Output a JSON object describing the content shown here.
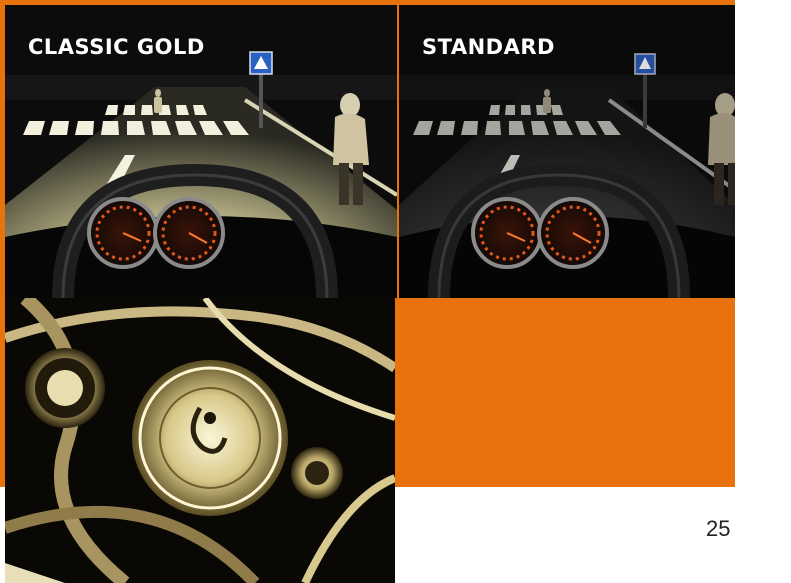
{
  "panels": {
    "left": {
      "label": "CLASSIC GOLD"
    },
    "right": {
      "label": "STANDARD"
    }
  },
  "page_number": "25",
  "colors": {
    "accent_orange": "#e8730c",
    "warm_beam": "#e8e2a8",
    "dim_road": "#2f2f2f"
  }
}
